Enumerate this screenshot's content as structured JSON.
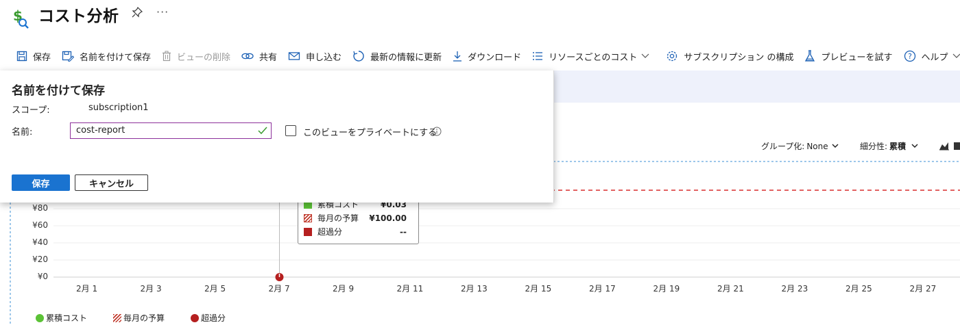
{
  "header": {
    "title": "コスト分析",
    "more_label": "···"
  },
  "toolbar": [
    {
      "label": "保存",
      "icon": "save-icon"
    },
    {
      "label": "名前を付けて保存",
      "icon": "save-as-icon"
    },
    {
      "label": "ビューの削除",
      "icon": "delete-icon",
      "disabled": true
    },
    {
      "label": "共有",
      "icon": "share-link-icon"
    },
    {
      "label": "申し込む",
      "icon": "mail-icon"
    },
    {
      "label": "最新の情報に更新",
      "icon": "refresh-icon"
    },
    {
      "label": "ダウンロード",
      "icon": "download-icon"
    },
    {
      "label": "リソースごとのコスト",
      "icon": "list-icon",
      "dropdown": true
    },
    {
      "label": "サブスクリプション の構成",
      "icon": "gear-icon"
    },
    {
      "label": "プレビューを試す",
      "icon": "flask-icon"
    },
    {
      "label": "ヘルプ",
      "icon": "help-icon",
      "dropdown": true
    }
  ],
  "dialog": {
    "title": "名前を付けて保存",
    "scope_label": "スコープ:",
    "scope_value": "subscription1",
    "name_label": "名前:",
    "name_value": "cost-report",
    "private_label": "このビューをプライベートにする",
    "save_label": "保存",
    "cancel_label": "キャンセル"
  },
  "chart_controls": {
    "group_label": "グループ化:",
    "group_value": "None",
    "granularity_label": "細分性:",
    "granularity_value": "累積"
  },
  "tooltip": {
    "rows": [
      {
        "name": "累積コスト",
        "value": "¥0.03"
      },
      {
        "name": "毎月の予算",
        "value": "¥100.00"
      },
      {
        "name": "超過分",
        "value": "--"
      }
    ]
  },
  "chart_data": {
    "type": "line",
    "x_tick_labels": [
      "2月 1",
      "2月 3",
      "2月 5",
      "2月 7",
      "2月 9",
      "2月 11",
      "2月 13",
      "2月 15",
      "2月 17",
      "2月 19",
      "2月 21",
      "2月 23",
      "2月 25",
      "2月 27"
    ],
    "y_tick_labels": [
      "¥0",
      "¥20",
      "¥40",
      "¥60",
      "¥80"
    ],
    "ylim": [
      0,
      100
    ],
    "series": [
      {
        "name": "累積コスト",
        "color": "#5bc236",
        "points": [
          {
            "x": "2月 7",
            "y": 0.03
          }
        ]
      },
      {
        "name": "毎月の予算",
        "color": "#d92d2d",
        "constant": 100
      },
      {
        "name": "超過分",
        "color": "#b51f1f",
        "points": [
          {
            "x": "2月 7",
            "y": 0
          }
        ]
      }
    ],
    "legend_position": "bottom-left",
    "grid": true
  },
  "colors": {
    "accent": "#1a73d0",
    "budget": "#d92d2d",
    "overage": "#b51f1f",
    "cost": "#5bc236"
  }
}
